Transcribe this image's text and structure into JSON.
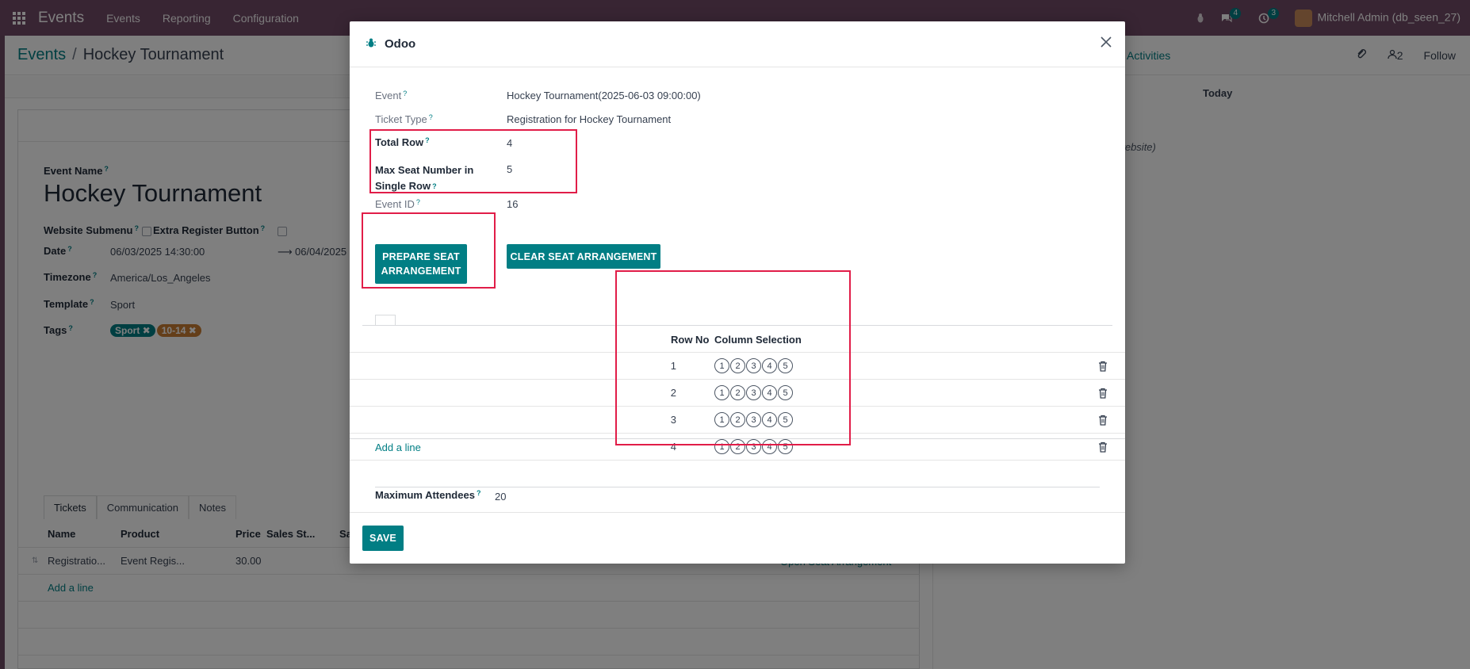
{
  "navbar": {
    "app_name": "Events",
    "menu": [
      "Events",
      "Reporting",
      "Configuration"
    ],
    "messages_badge": "4",
    "activities_badge": "3",
    "user": "Mitchell Admin (db_seen_27)"
  },
  "breadcrumb": {
    "parent": "Events",
    "current": "Hockey Tournament"
  },
  "control_panel": {
    "activities": "Activities",
    "followers_count": "2",
    "follow": "Follow"
  },
  "chatter": {
    "today": "Today",
    "note": "nt website)"
  },
  "form": {
    "event_name_label": "Event Name",
    "event_name": "Hockey Tournament",
    "website_submenu_label": "Website Submenu",
    "extra_register_label": "Extra Register Button",
    "date_label": "Date",
    "date_start": "06/03/2025 14:30:00",
    "date_end": "06/04/2025",
    "timezone_label": "Timezone",
    "timezone": "America/Los_Angeles",
    "template_label": "Template",
    "template": "Sport",
    "tags_label": "Tags",
    "tags": [
      "Sport",
      "10-14"
    ],
    "tabs": [
      "Tickets",
      "Communication",
      "Notes"
    ],
    "ticket_columns": [
      "Name",
      "Product",
      "Price",
      "Sales St...",
      "Sa"
    ],
    "ticket_row": {
      "name": "Registratio...",
      "product": "Event Regis...",
      "price": "30.00"
    },
    "add_line": "Add a line",
    "open_seat": "Open Seat Arrangement"
  },
  "dialog": {
    "title": "Odoo",
    "event_label": "Event",
    "event_value": "Hockey Tournament(2025-06-03 09:00:00)",
    "ticket_type_label": "Ticket Type",
    "ticket_type_value": "Registration for Hockey Tournament",
    "total_row_label": "Total Row",
    "total_row_value": "4",
    "max_seat_label_1": "Max Seat Number in",
    "max_seat_label_2": "Single Row",
    "max_seat_value": "5",
    "event_id_label": "Event ID",
    "event_id_value": "16",
    "prepare_btn_1": "PREPARE SEAT",
    "prepare_btn_2": "ARRANGEMENT",
    "clear_btn": "CLEAR SEAT ARRANGEMENT",
    "col_row_no": "Row No",
    "col_selection": "Column Selection",
    "rows": [
      {
        "row_no": "1",
        "seats": [
          "1",
          "2",
          "3",
          "4",
          "5"
        ]
      },
      {
        "row_no": "2",
        "seats": [
          "1",
          "2",
          "3",
          "4",
          "5"
        ]
      },
      {
        "row_no": "3",
        "seats": [
          "1",
          "2",
          "3",
          "4",
          "5"
        ]
      },
      {
        "row_no": "4",
        "seats": [
          "1",
          "2",
          "3",
          "4",
          "5"
        ]
      }
    ],
    "add_line": "Add a line",
    "max_attendees_label": "Maximum Attendees",
    "max_attendees_value": "20",
    "save": "SAVE"
  },
  "colors": {
    "brand": "#714b67",
    "accent": "#017e84",
    "highlight": "#e02424"
  }
}
